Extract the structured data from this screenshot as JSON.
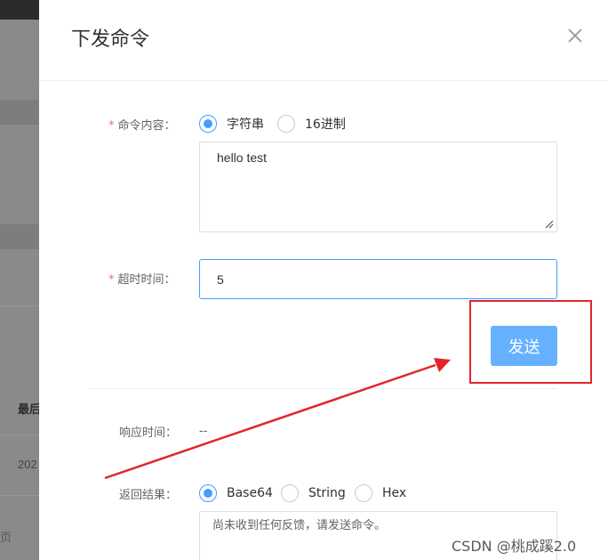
{
  "background": {
    "row1_text": "最后",
    "row2_text": "202",
    "row3_text": "页"
  },
  "dialog": {
    "title": "下发命令",
    "command_content": {
      "label": "命令内容：",
      "options": [
        "字符串",
        "16进制"
      ],
      "selected": "字符串",
      "value": "hello test"
    },
    "timeout": {
      "label": "超时时间：",
      "value": "5"
    },
    "send_label": "发送",
    "response_time": {
      "label": "响应时间：",
      "value": "--"
    },
    "result": {
      "label": "返回结果：",
      "options": [
        "Base64",
        "String",
        "Hex"
      ],
      "selected": "Base64",
      "value": "尚未收到任何反馈，请发送命令。"
    },
    "required_mark": "*"
  },
  "colors": {
    "primary": "#409eff",
    "send_button": "#66b1ff",
    "annotation_red": "#e0262c",
    "required": "#f56c6c"
  },
  "icons": {
    "close": "close-icon (x)",
    "resize": "resize-grip-icon"
  },
  "watermark": "CSDN @桃成蹊2.0"
}
